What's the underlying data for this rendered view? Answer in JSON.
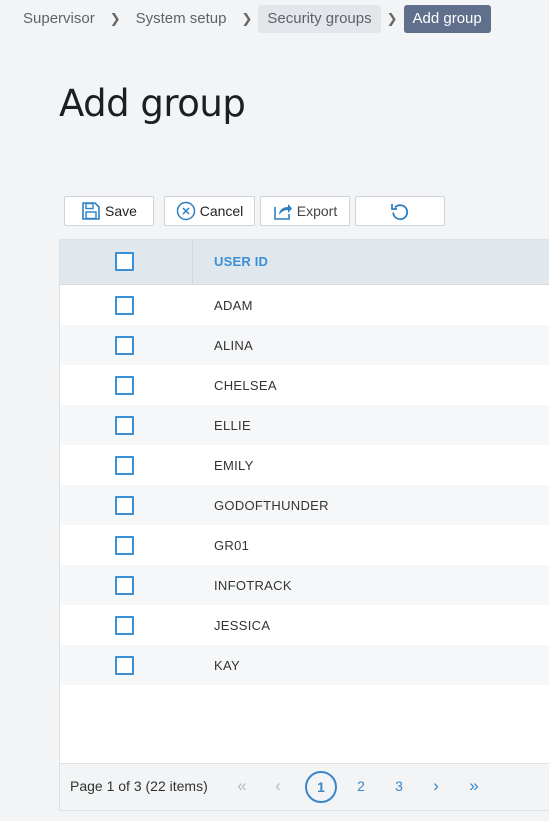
{
  "breadcrumb": {
    "items": [
      {
        "label": "Supervisor"
      },
      {
        "label": "System setup"
      },
      {
        "label": "Security groups"
      },
      {
        "label": "Add group"
      }
    ]
  },
  "page": {
    "title": "Add group"
  },
  "toolbar": {
    "save_label": "Save",
    "cancel_label": "Cancel",
    "export_label": "Export"
  },
  "grid": {
    "column_header": "USER ID",
    "rows": [
      {
        "user_id": "ADAM"
      },
      {
        "user_id": "ALINA"
      },
      {
        "user_id": "CHELSEA"
      },
      {
        "user_id": "ELLIE"
      },
      {
        "user_id": "EMILY"
      },
      {
        "user_id": "GODOFTHUNDER"
      },
      {
        "user_id": "GR01"
      },
      {
        "user_id": "INFOTRACK"
      },
      {
        "user_id": "JESSICA"
      },
      {
        "user_id": "KAY"
      }
    ]
  },
  "pager": {
    "info": "Page 1 of 3 (22 items)",
    "pages": [
      "1",
      "2",
      "3"
    ],
    "current_page": "1"
  },
  "colors": {
    "accent": "#3a86c8",
    "active_crumb": "#5f6f8c",
    "header_bg": "#e0e8ee"
  }
}
